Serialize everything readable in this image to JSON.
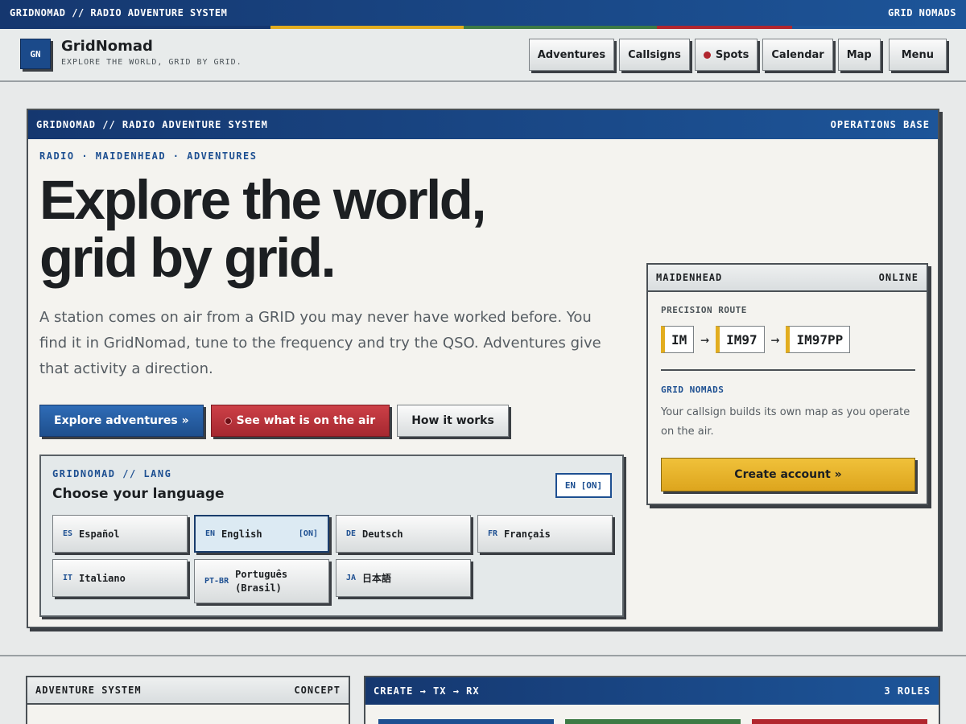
{
  "topbar": {
    "left": "GRIDNOMAD // RADIO ADVENTURE SYSTEM",
    "right": "GRID NOMADS"
  },
  "stripe_colors": [
    "#15376f",
    "#e2ad1f",
    "#3d7a45",
    "#b1262e",
    "#1d5599"
  ],
  "header": {
    "logo_text": "GN",
    "brand": "GridNomad",
    "tagline": "EXPLORE THE WORLD, GRID BY GRID.",
    "nav": {
      "adventures": "Adventures",
      "callsigns": "Callsigns",
      "spots": "Spots",
      "calendar": "Calendar",
      "map": "Map",
      "menu": "Menu"
    }
  },
  "hero": {
    "head_left": "GRIDNOMAD // RADIO ADVENTURE SYSTEM",
    "head_right": "OPERATIONS BASE",
    "kicker": "RADIO · MAIDENHEAD · ADVENTURES",
    "title_line1": "Explore the world,",
    "title_line2": "grid by grid.",
    "lead": "A station comes on air from a GRID you may never have worked before. You find it in GridNomad, tune to the frequency and try the QSO. Adventures give that activity a direction.",
    "cta": {
      "explore": "Explore adventures »",
      "on_air": "See what is on the air",
      "how": "How it works"
    }
  },
  "language": {
    "kicker": "GRIDNOMAD // LANG",
    "title": "Choose your language",
    "current": "EN [ON]",
    "items": [
      {
        "code": "ES",
        "name": "Español"
      },
      {
        "code": "EN",
        "name": "English",
        "on": "[ON]"
      },
      {
        "code": "DE",
        "name": "Deutsch"
      },
      {
        "code": "FR",
        "name": "Français"
      },
      {
        "code": "IT",
        "name": "Italiano"
      },
      {
        "code": "PT-BR",
        "name": "Português (Brasil)"
      },
      {
        "code": "JA",
        "name": "日本語"
      }
    ]
  },
  "maidenhead": {
    "head_left": "MAIDENHEAD",
    "head_right": "ONLINE",
    "route_label": "PRECISION ROUTE",
    "route": [
      "IM",
      "IM97",
      "IM97PP"
    ],
    "arrow": "→",
    "nomads_label": "GRID NOMADS",
    "nomads_text": "Your callsign builds its own map as you operate on the air.",
    "create": "Create account »"
  },
  "adventure_panel": {
    "head_left": "ADVENTURE SYSTEM",
    "head_right": "CONCEPT"
  },
  "roles_panel": {
    "head_left": "CREATE → TX → RX",
    "head_right": "3 ROLES"
  }
}
